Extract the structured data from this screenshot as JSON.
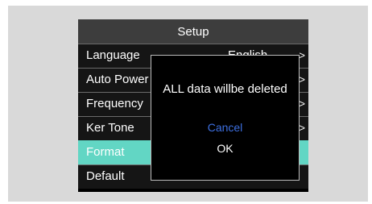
{
  "screen": {
    "title": "Setup",
    "menu": [
      {
        "label": "Language",
        "value": "English",
        "chevron": ">"
      },
      {
        "label": "Auto Power Off",
        "value": "",
        "chevron": ">"
      },
      {
        "label": "Frequency",
        "value": "",
        "chevron": ">"
      },
      {
        "label": "Ker Tone",
        "value": "",
        "chevron": ">"
      },
      {
        "label": "Format",
        "value": "",
        "chevron": ""
      },
      {
        "label": "Default",
        "value": "",
        "chevron": ""
      }
    ],
    "selected_index": 4
  },
  "dialog": {
    "message": "ALL data willbe deleted",
    "cancel_label": "Cancel",
    "ok_label": "OK"
  },
  "colors": {
    "selected": "#62d6c4",
    "cancel": "#3d6fe0",
    "title_bar": "#3d3d3d"
  }
}
